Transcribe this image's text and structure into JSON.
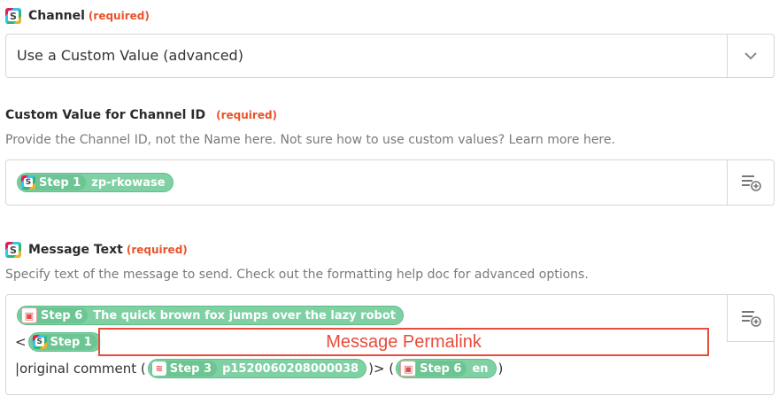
{
  "channel": {
    "label": "Channel",
    "required": "(required)",
    "value": "Use a Custom Value (advanced)"
  },
  "custom_channel": {
    "label": "Custom Value for Channel ID",
    "required": "(required)",
    "help": "Provide the Channel ID, not the Name here. Not sure how to use custom values? Learn more here.",
    "pill": {
      "step": "Step 1",
      "value": "zp-rkowase"
    }
  },
  "message": {
    "label": "Message Text",
    "required": "(required)",
    "help": "Specify text of the message to send. Check out the formatting help doc for advanced options.",
    "line1_pill": {
      "step": "Step 6",
      "value": "The quick brown fox jumps over the lazy robot"
    },
    "line2_prefix": "<",
    "line2_pill": {
      "step": "Step 1"
    },
    "annotation": "Message Permalink",
    "line3_text_before": "|original comment (",
    "line3_pill_a": {
      "step": "Step 3",
      "value": "p1520060208000038"
    },
    "line3_text_mid": ")> (",
    "line3_pill_b": {
      "step": "Step 6",
      "value": "en"
    },
    "line3_text_after": ")"
  }
}
